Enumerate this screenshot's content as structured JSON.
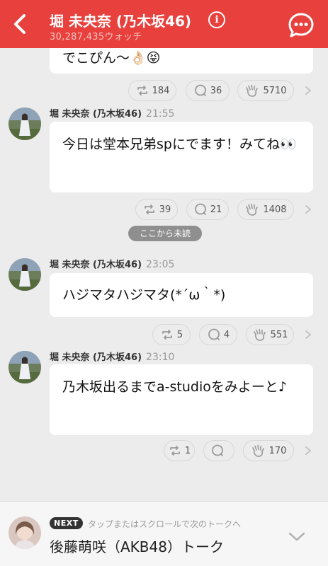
{
  "header": {
    "title": "堀 未央奈 (乃木坂46)",
    "watch_count": "30,287,435ウォッチ",
    "background_color": "#e8413d"
  },
  "top_message": {
    "text": "でこぴん〜👌🏻😝",
    "reactions": {
      "retweets": "184",
      "comments": "36",
      "claps": "5710"
    }
  },
  "messages": [
    {
      "name": "堀 未央奈 (乃木坂46)",
      "time": "21:55",
      "text": "今日は堂本兄弟spにでます！みてね👀",
      "reactions": {
        "retweets": "39",
        "comments": "21",
        "claps": "1408"
      }
    },
    {
      "name": "堀 未央奈 (乃木坂46)",
      "time": "23:05",
      "text": "ハジマタハジマタ(*´ω｀*)",
      "reactions": {
        "retweets": "5",
        "comments": "4",
        "claps": "551"
      }
    },
    {
      "name": "堀 未央奈 (乃木坂46)",
      "time": "23:10",
      "text": "乃木坂出るまでa-studioをみよーと♪",
      "reactions": {
        "retweets": "1",
        "comments": "",
        "claps": "170"
      }
    }
  ],
  "unread_divider": "ここから未読",
  "next_talk": {
    "badge": "NEXT",
    "hint": "タップまたはスクロールで次のトークへ",
    "title": "後藤萌咲（AKB48）トーク"
  },
  "icons": {
    "back": "chevron-left-icon",
    "info": "info-icon",
    "chat": "chat-bubble-icon",
    "retweet": "retweet-icon",
    "comment": "comment-icon",
    "clap": "clap-hand-icon",
    "next": "chevron-right-icon",
    "expand": "chevron-down-icon"
  }
}
